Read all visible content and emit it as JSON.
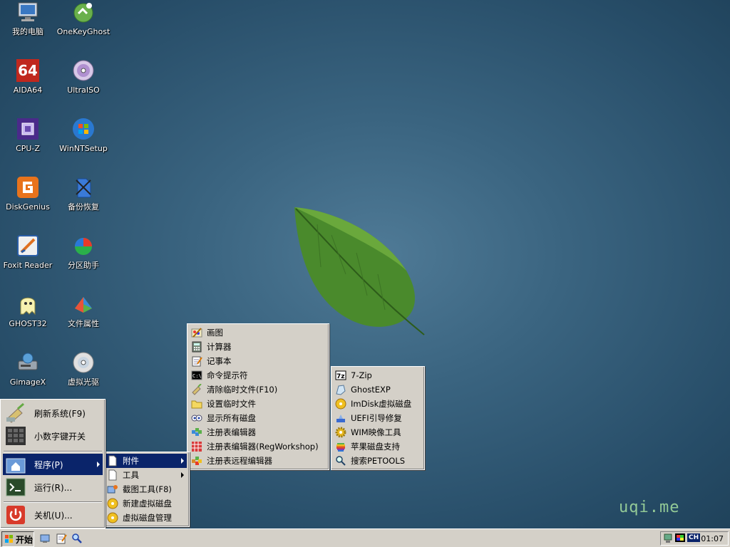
{
  "desktop": {
    "icons": [
      {
        "label": "我的电脑"
      },
      {
        "label": "OneKeyGhost"
      },
      {
        "label": "AIDA64"
      },
      {
        "label": "UltraISO"
      },
      {
        "label": "CPU-Z"
      },
      {
        "label": "WinNTSetup"
      },
      {
        "label": "DiskGenius"
      },
      {
        "label": "备份恢复"
      },
      {
        "label": "Foxit Reader"
      },
      {
        "label": "分区助手"
      },
      {
        "label": "GHOST32"
      },
      {
        "label": "文件属性"
      },
      {
        "label": "GimageX"
      },
      {
        "label": "虚拟光驱"
      }
    ],
    "aida_badge": "64",
    "brand": "uqi.me"
  },
  "start_menu": {
    "items": [
      {
        "label": "刷新系统(F9)"
      },
      {
        "label": "小数字键开关"
      },
      {
        "label": "程序(P)"
      },
      {
        "label": "运行(R)..."
      },
      {
        "label": "关机(U)..."
      }
    ]
  },
  "programs_menu": {
    "items": [
      {
        "label": "附件"
      },
      {
        "label": "工具"
      },
      {
        "label": "截图工具(F8)"
      },
      {
        "label": "新建虚拟磁盘"
      },
      {
        "label": "虚拟磁盘管理"
      }
    ]
  },
  "accessories_menu": {
    "items": [
      {
        "label": "画图"
      },
      {
        "label": "计算器"
      },
      {
        "label": "记事本"
      },
      {
        "label": "命令提示符"
      },
      {
        "label": "清除临时文件(F10)"
      },
      {
        "label": "设置临时文件"
      },
      {
        "label": "显示所有磁盘"
      },
      {
        "label": "注册表编辑器"
      },
      {
        "label": "注册表编辑器(RegWorkshop)"
      },
      {
        "label": "注册表远程编辑器"
      }
    ]
  },
  "tools_menu": {
    "items": [
      {
        "label": "7-Zip"
      },
      {
        "label": "GhostEXP"
      },
      {
        "label": "ImDisk虚拟磁盘"
      },
      {
        "label": "UEFI引导修复"
      },
      {
        "label": "WIM映像工具"
      },
      {
        "label": "苹果磁盘支持"
      },
      {
        "label": "搜索PETOOLS"
      }
    ]
  },
  "taskbar": {
    "start_label": "开始",
    "tray_lang": "CH",
    "clock": "01:07"
  },
  "colors": {
    "selection": "#0a246a",
    "menu_bg": "#d4d0c8",
    "desktop": "#2f5672"
  }
}
